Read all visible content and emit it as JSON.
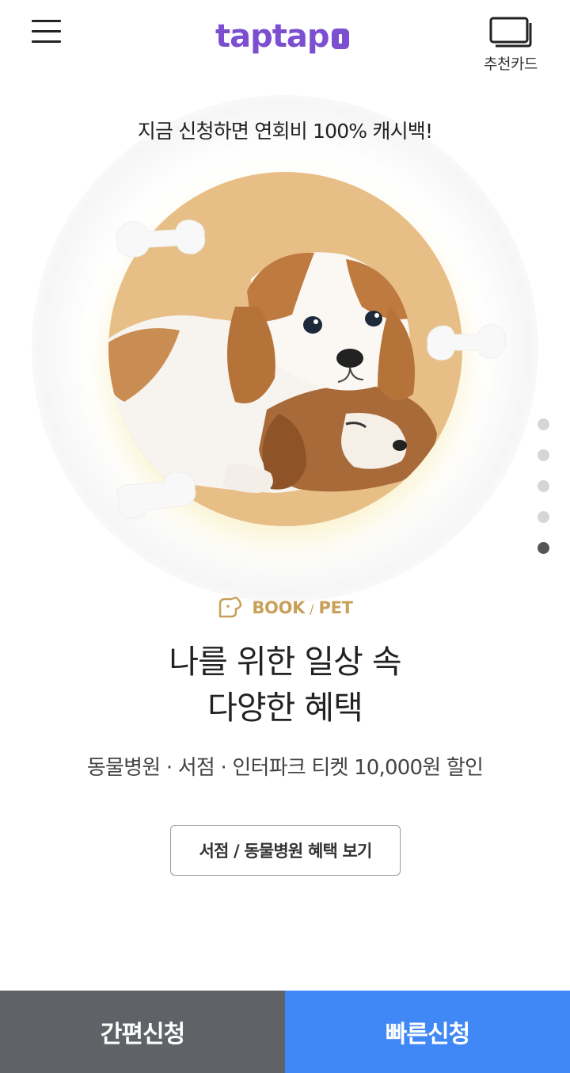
{
  "header": {
    "logo_text": "taptap",
    "recommend_label": "추천카드"
  },
  "hero": {
    "promo_text": "지금 신청하면 연회비 100% 캐시백!",
    "image_subject": "puppies",
    "bg_color": "#e8be87"
  },
  "carousel": {
    "total": 5,
    "active_index": 4
  },
  "content": {
    "category_primary": "BOOK",
    "category_separator": "/",
    "category_secondary": "PET",
    "headline_line1": "나를 위한 일상 속",
    "headline_line2": "다양한 혜택",
    "subtext": "동물병원 · 서점 · 인터파크 티켓 10,000원 할인",
    "benefit_button": "서점 / 동물병원 혜택 보기"
  },
  "bottom_bar": {
    "easy_apply": "간편신청",
    "quick_apply": "빠른신청"
  },
  "colors": {
    "brand": "#7b4fd0",
    "accent_gold": "#c9a05a",
    "easy_bg": "#5f6267",
    "quick_bg": "#4088f5"
  }
}
